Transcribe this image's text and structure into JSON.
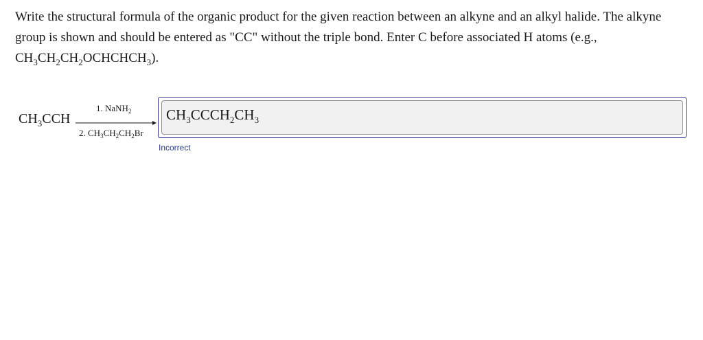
{
  "question": {
    "line1": "Write the structural formula of the organic product for the given reaction between an alkyne and an alkyl halide. The alkyne",
    "line2": "group is shown and should be entered as \"CC\" without the triple bond. Enter C before associated H atoms (e.g.,",
    "example": {
      "p1": "CH",
      "s1": "3",
      "p2": "CH",
      "s2": "2",
      "p3": "CH",
      "s3": "2",
      "p4": "OCHCHCH",
      "s4": "3",
      "p5": ")."
    }
  },
  "reaction": {
    "reactant": {
      "p1": "CH",
      "s1": "3",
      "p2": "CCH"
    },
    "reagent1": {
      "p1": "1. NaNH",
      "s1": "2"
    },
    "reagent2": {
      "p1": "2. CH",
      "s1": "3",
      "p2": "CH",
      "s2": "2",
      "p3": "CH",
      "s3": "2",
      "p4": "Br"
    }
  },
  "answer": {
    "p1": "CH",
    "s1": "3",
    "p2": "CCCH",
    "s2": "2",
    "p3": "CH",
    "s3": "3"
  },
  "status": {
    "text": "Incorrect",
    "color": "#2b3a8f"
  },
  "colors": {
    "input_border": "#3c3c96",
    "input_background": "#f1f1f1"
  }
}
